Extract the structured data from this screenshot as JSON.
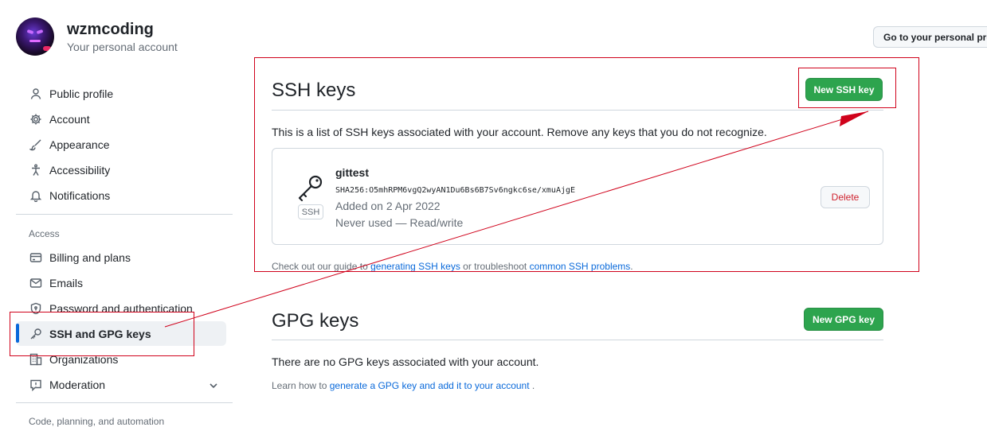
{
  "header": {
    "username": "wzmcoding",
    "subtitle": "Your personal account",
    "goto_button": "Go to your personal profile"
  },
  "sidebar": {
    "items": [
      {
        "label": "Public profile",
        "icon": "person-icon"
      },
      {
        "label": "Account",
        "icon": "gear-icon"
      },
      {
        "label": "Appearance",
        "icon": "paintbrush-icon"
      },
      {
        "label": "Accessibility",
        "icon": "accessibility-icon"
      },
      {
        "label": "Notifications",
        "icon": "bell-icon"
      }
    ],
    "access_heading": "Access",
    "access_items": [
      {
        "label": "Billing and plans",
        "icon": "credit-card-icon"
      },
      {
        "label": "Emails",
        "icon": "mail-icon"
      },
      {
        "label": "Password and authentication",
        "icon": "shield-lock-icon"
      },
      {
        "label": "SSH and GPG keys",
        "icon": "key-icon",
        "active": true
      },
      {
        "label": "Organizations",
        "icon": "organization-icon"
      },
      {
        "label": "Moderation",
        "icon": "report-icon"
      }
    ],
    "next_heading": "Code, planning, and automation"
  },
  "ssh": {
    "title": "SSH keys",
    "new_button": "New SSH key",
    "description": "This is a list of SSH keys associated with your account. Remove any keys that you do not recognize.",
    "key": {
      "name": "gittest",
      "fingerprint": "SHA256:O5mhRPM6vgQ2wyAN1Du6Bs6B7Sv6ngkc6se/xmuAjgE",
      "added": "Added on 2 Apr 2022",
      "usage": "Never used — Read/write",
      "badge": "SSH",
      "delete_label": "Delete"
    },
    "guide_prefix": "Check out our guide to",
    "guide_link1": "generating SSH keys",
    "guide_mid": "or troubleshoot",
    "guide_link2": "common SSH problems",
    "guide_suffix": "."
  },
  "gpg": {
    "title": "GPG keys",
    "new_button": "New GPG key",
    "empty": "There are no GPG keys associated with your account.",
    "learn_prefix": "Learn how to",
    "learn_link": "generate a GPG key and add it to your account",
    "learn_suffix": "."
  },
  "colors": {
    "accent": "#0969da",
    "green_button": "#2da44e",
    "annotation_red": "#d0021b",
    "danger": "#cf222e"
  }
}
